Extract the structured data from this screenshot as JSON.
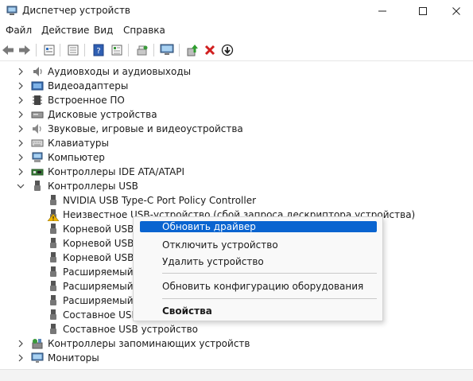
{
  "window": {
    "title": "Диспетчер устройств",
    "minimize_glyph": "—",
    "maximize_glyph": "☐",
    "close_glyph": "✕"
  },
  "menu": [
    {
      "label": "Файл"
    },
    {
      "label": "Действие"
    },
    {
      "label": "Вид"
    },
    {
      "label": "Справка"
    }
  ],
  "toolbar": {
    "buttons": [
      "back-icon",
      "forward-icon",
      "properties-icon",
      "view-list-icon",
      "help-icon",
      "view-details-icon",
      "scan-hardware-icon",
      "monitor-icon",
      "update-driver-icon",
      "uninstall-icon",
      "disable-icon"
    ]
  },
  "tree": {
    "rows": [
      {
        "label": "Аудиовходы и аудиовыходы",
        "icon": "audio-icon",
        "expanded": false
      },
      {
        "label": "Видеоадаптеры",
        "icon": "display-adapter-icon",
        "expanded": false
      },
      {
        "label": "Встроенное ПО",
        "icon": "firmware-icon",
        "expanded": false
      },
      {
        "label": "Дисковые устройства",
        "icon": "disk-icon",
        "expanded": false
      },
      {
        "label": "Звуковые, игровые и видеоустройства",
        "icon": "speaker-icon",
        "expanded": false
      },
      {
        "label": "Клавиатуры",
        "icon": "keyboard-icon",
        "expanded": false
      },
      {
        "label": "Компьютер",
        "icon": "computer-icon",
        "expanded": false
      },
      {
        "label": "Контроллеры IDE ATA/ATAPI",
        "icon": "ide-controller-icon",
        "expanded": false
      },
      {
        "label": "Контроллеры USB",
        "icon": "usb-icon",
        "expanded": true
      },
      {
        "label": "NVIDIA USB Type-C Port Policy Controller",
        "icon": "usb-icon",
        "child": true
      },
      {
        "label": "Неизвестное USB-устройство (сбой запроса дескриптора устройства)",
        "icon": "usb-warning-icon",
        "child": true
      },
      {
        "label": "Корневой USB-к",
        "icon": "usb-icon",
        "child": true
      },
      {
        "label": "Корневой USB-к",
        "icon": "usb-icon",
        "child": true
      },
      {
        "label": "Корневой USB-к",
        "icon": "usb-icon",
        "child": true
      },
      {
        "label": "Расширяемый х",
        "icon": "usb-icon",
        "child": true
      },
      {
        "label": "Расширяемый х",
        "icon": "usb-icon",
        "child": true
      },
      {
        "label": "Расширяемый х",
        "icon": "usb-icon",
        "child": true
      },
      {
        "label": "Составное USB у",
        "icon": "usb-icon",
        "child": true
      },
      {
        "label": "Составное USB устройство",
        "icon": "usb-icon",
        "child": true
      },
      {
        "label": "Контроллеры запоминающих устройств",
        "icon": "storage-controller-icon",
        "expanded": false
      },
      {
        "label": "Мониторы",
        "icon": "monitor-icon",
        "expanded": false
      }
    ]
  },
  "context_menu": {
    "items": [
      {
        "label": "Обновить драйвер",
        "highlighted": true
      },
      {
        "label": "Отключить устройство"
      },
      {
        "label": "Удалить устройство"
      },
      {
        "label": "Обновить конфигурацию оборудования"
      },
      {
        "label": "Свойства",
        "bold": true
      }
    ]
  },
  "colors": {
    "accent": "#0a64d0",
    "warning": "#f0b400",
    "uninstall_red": "#d11f1f"
  }
}
